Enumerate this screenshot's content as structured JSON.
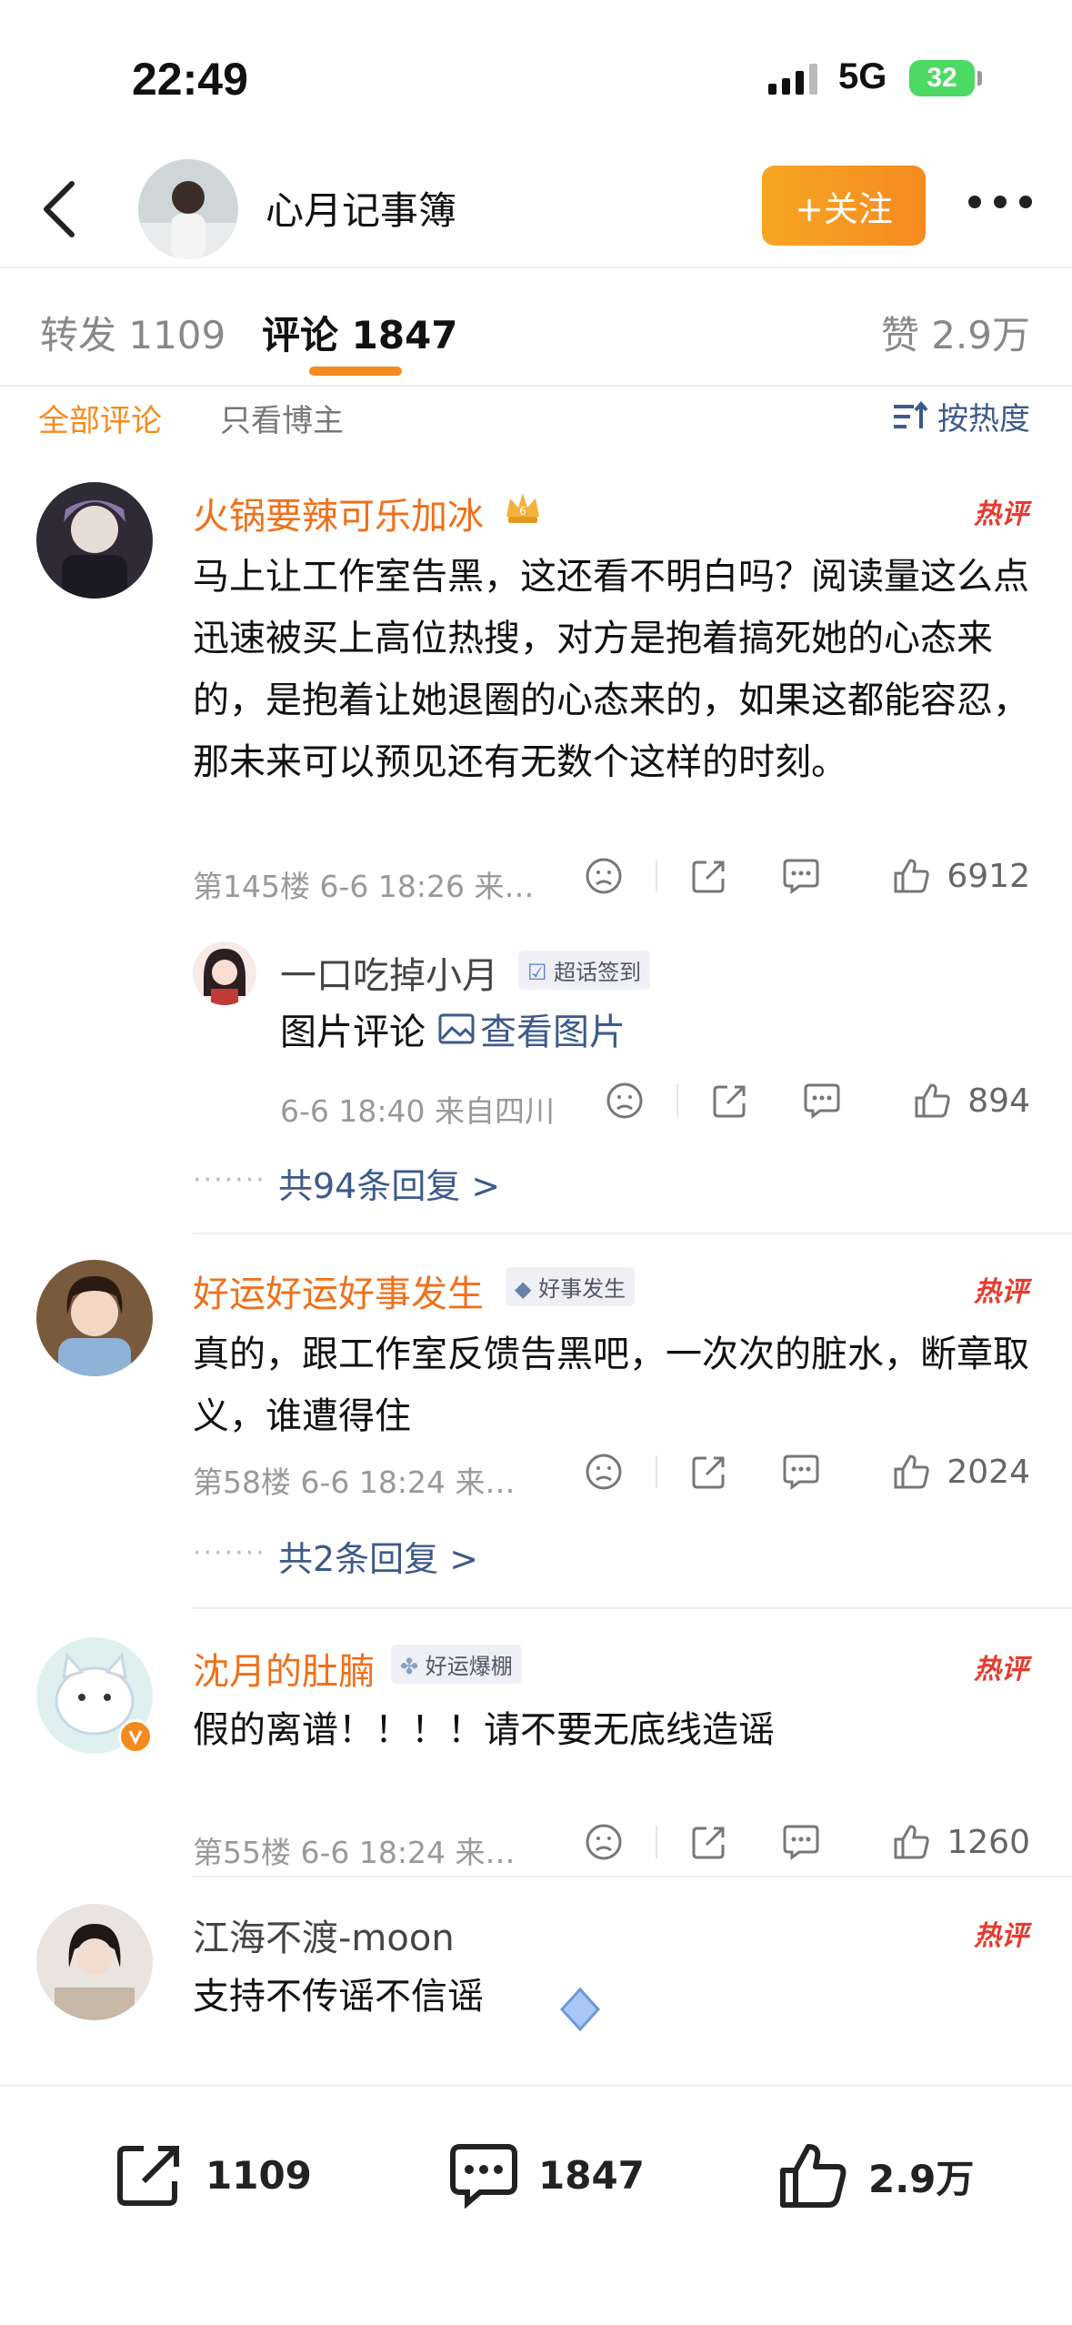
{
  "status": {
    "time": "22:49",
    "network": "5G",
    "battery": "32"
  },
  "nav": {
    "title": "心月记事簿",
    "follow_label": "+关注"
  },
  "tabs": {
    "repost": "转发 1109",
    "comments": "评论 1847",
    "likes": "赞 2.9万"
  },
  "filter": {
    "all": "全部评论",
    "host_only": "只看博主",
    "sort": "按热度"
  },
  "hot_label": "热评",
  "comments": [
    {
      "user": "火锅要辣可乐加冰",
      "level": "6",
      "text": "马上让工作室告黑，这还看不明白吗？阅读量这么点迅速被买上高位热搜，对方是抱着搞死她的心态来的，是抱着让她退圈的心态来的，如果这都能容忍，那未来可以预见还有无数个这样的时刻。",
      "meta": "第145楼 6-6 18:26 来…",
      "likes": "6912",
      "reply": {
        "user": "一口吃掉小月",
        "badge": "超话签到",
        "text_prefix": "图片评论",
        "text_link": "查看图片",
        "meta": "6-6 18:40 来自四川",
        "likes": "894"
      },
      "more_replies": "共94条回复 >"
    },
    {
      "user": "好运好运好事发生",
      "badge": "好事发生",
      "text": "真的，跟工作室反馈告黑吧，一次次的脏水，断章取义，谁遭得住",
      "meta": "第58楼 6-6 18:24 来…",
      "likes": "2024",
      "more_replies": "共2条回复 >"
    },
    {
      "user": "沈月的肚腩",
      "badge": "好运爆棚",
      "text": "假的离谱！！！！请不要无底线造谣",
      "meta": "第55楼 6-6 18:24 来…",
      "likes": "1260"
    },
    {
      "user": "江海不渡-moon",
      "text": "支持不传谣不信谣"
    }
  ],
  "bottom_bar": {
    "repost": "1109",
    "comments": "1847",
    "likes": "2.9万"
  },
  "colors": {
    "accent": "#f58a1f",
    "link": "#3d5a8a",
    "hot": "#e63b2e"
  }
}
